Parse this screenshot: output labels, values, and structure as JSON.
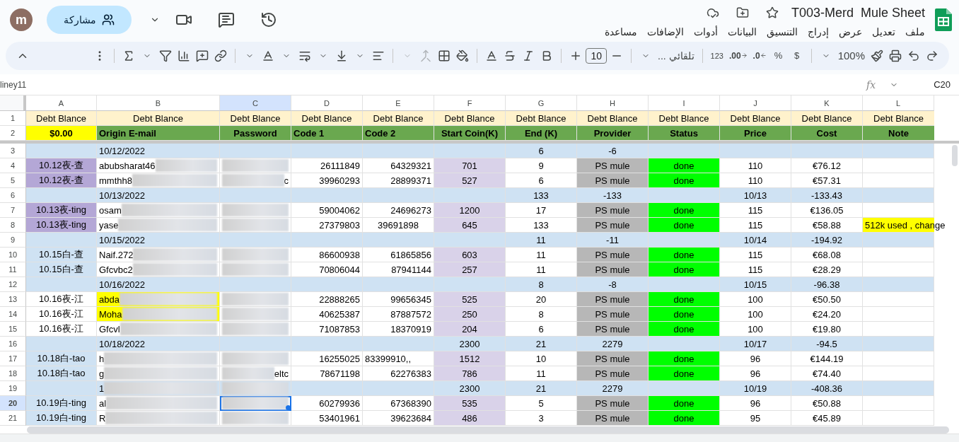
{
  "document": {
    "title": "T003-Merd  Mule Sheet"
  },
  "menu": [
    "ملف",
    "تعديل",
    "عرض",
    "إدراج",
    "التنسيق",
    "البيانات",
    "أدوات",
    "الإضافات",
    "مساعدة"
  ],
  "account": {
    "initial": "m"
  },
  "share_button": {
    "label": "مشاركة"
  },
  "toolbar": {
    "zoom": "100%",
    "currency": "$",
    "percent": "%",
    "decrease_decimal": ".0",
    "increase_decimal": ".00",
    "number_format": "123",
    "font": "تلقائي ...",
    "font_size": "10"
  },
  "formula_bar": {
    "name_box": "C20",
    "content": "liney11",
    "fx_label": "fx"
  },
  "columns": [
    {
      "letter": "A",
      "selected": false
    },
    {
      "letter": "B",
      "selected": false
    },
    {
      "letter": "C",
      "selected": true
    },
    {
      "letter": "D",
      "selected": false
    },
    {
      "letter": "E",
      "selected": false
    },
    {
      "letter": "F",
      "selected": false
    },
    {
      "letter": "G",
      "selected": false
    },
    {
      "letter": "H",
      "selected": false
    },
    {
      "letter": "I",
      "selected": false
    },
    {
      "letter": "J",
      "selected": false
    },
    {
      "letter": "K",
      "selected": false
    },
    {
      "letter": "L",
      "selected": false
    }
  ],
  "rows": [
    {
      "number": "1",
      "kind": "title",
      "selected": false,
      "cells": [
        "Debt Blance",
        "Debt Blance",
        "Debt Blance",
        "Debt Blance",
        "Debt Blance",
        "Debt Blance",
        "Debt Blance",
        "Debt Blance",
        "Debt Blance",
        "Debt Blance",
        "Debt Blance",
        "Debt Blance"
      ]
    },
    {
      "number": "2",
      "kind": "header",
      "selected": false,
      "cells": [
        {
          "text": "$0.00",
          "color": "#ffff00"
        },
        "Origin E-mail",
        "Password",
        "Code 1",
        "Code 2",
        "Start Coin(K)",
        "End (K)",
        "Provider",
        "Status",
        "Price",
        "Cost",
        "Note"
      ]
    },
    {
      "number": "3",
      "kind": "date",
      "selected": false,
      "cells": [
        "",
        "10/12/2022",
        "",
        "",
        "",
        "",
        "6",
        "-6",
        "",
        "",
        "",
        ""
      ]
    },
    {
      "number": "4",
      "kind": "entry",
      "selected": false,
      "cells": [
        {
          "text": "10.12夜-查",
          "color": "#b4a7d6"
        },
        {
          "text": "abubsharat46",
          "redacted": true
        },
        {
          "text": "",
          "redacted": true
        },
        "26111849",
        "64329321",
        "701",
        "9",
        "PS mule",
        "done",
        "110",
        "€76.12",
        ""
      ]
    },
    {
      "number": "5",
      "kind": "entry",
      "selected": false,
      "cells": [
        {
          "text": "10.12夜-查",
          "color": "#b4a7d6"
        },
        {
          "text": "mmthh8",
          "redacted": true
        },
        {
          "text": "c",
          "redacted": true
        },
        "39960293",
        "28899371",
        "527",
        "6",
        "PS mule",
        "done",
        "110",
        "€57.31",
        ""
      ]
    },
    {
      "number": "6",
      "kind": "date",
      "selected": false,
      "cells": [
        "",
        "10/13/2022",
        "",
        "",
        "",
        "",
        "133",
        "-133",
        "",
        "10/13",
        "-133.43",
        ""
      ]
    },
    {
      "number": "7",
      "kind": "entry",
      "selected": false,
      "cells": [
        {
          "text": "10.13夜-ting",
          "color": "#b4a7d6"
        },
        {
          "text": "osam",
          "redacted": true
        },
        {
          "text": "",
          "redacted": true
        },
        "59004062",
        "24696273",
        "1200",
        "17",
        "PS mule",
        "done",
        "115",
        "€136.05",
        ""
      ]
    },
    {
      "number": "8",
      "kind": "entry",
      "selected": false,
      "cells": [
        {
          "text": "10.13夜-ting",
          "color": "#b4a7d6"
        },
        {
          "text": "yase",
          "redacted": true
        },
        {
          "text": "",
          "redacted": true
        },
        "27379803",
        {
          "text": "39691898",
          "centered": true
        },
        "645",
        "133",
        "PS mule",
        "done",
        "115",
        "€58.88",
        {
          "text": "512k used , change",
          "color": "#ffff00"
        }
      ]
    },
    {
      "number": "9",
      "kind": "date",
      "selected": false,
      "cells": [
        "",
        "10/15/2022",
        "",
        "",
        "",
        "",
        "11",
        "-11",
        "",
        "10/14",
        "-194.92",
        ""
      ]
    },
    {
      "number": "10",
      "kind": "entry",
      "selected": false,
      "cells": [
        {
          "text": "10.15白-查",
          "color": "#cfe2f3"
        },
        {
          "text": "Naif.272",
          "redacted": true
        },
        {
          "text": "",
          "redacted": true
        },
        "86600938",
        "61865856",
        "603",
        "11",
        "PS mule",
        "done",
        "115",
        "€68.08",
        ""
      ]
    },
    {
      "number": "11",
      "kind": "entry",
      "selected": false,
      "cells": [
        {
          "text": "10.15白-查",
          "color": "#cfe2f3"
        },
        {
          "text": "Gfcvbc2",
          "redacted": true
        },
        {
          "text": "",
          "redacted": true
        },
        "70806044",
        "87941144",
        "257",
        "11",
        "PS mule",
        "done",
        "115",
        "€28.29",
        ""
      ]
    },
    {
      "number": "12",
      "kind": "date",
      "selected": false,
      "cells": [
        "",
        "10/16/2022",
        "",
        "",
        "",
        "",
        "8",
        "-8",
        "",
        "10/15",
        "-96.38",
        ""
      ]
    },
    {
      "number": "13",
      "kind": "entry",
      "selected": false,
      "cells": [
        "10.16夜-江",
        {
          "text": "abda",
          "redacted": true,
          "color": "#ffff00"
        },
        {
          "text": "",
          "redacted": true
        },
        "22888265",
        "99656345",
        "525",
        "20",
        "PS mule",
        "done",
        "100",
        "€50.50",
        ""
      ]
    },
    {
      "number": "14",
      "kind": "entry",
      "selected": false,
      "cells": [
        "10.16夜-江",
        {
          "text": "Moha",
          "redacted": true,
          "color": "#ffff00"
        },
        {
          "text": "",
          "redacted": true
        },
        "40625387",
        "87887572",
        "250",
        "8",
        "PS mule",
        "done",
        "100",
        "€24.20",
        ""
      ]
    },
    {
      "number": "15",
      "kind": "entry",
      "selected": false,
      "cells": [
        "10.16夜-江",
        {
          "text": "Gfcvl",
          "redacted": true
        },
        {
          "text": "",
          "redacted": true
        },
        "71087853",
        "18370919",
        "204",
        "6",
        "PS mule",
        "done",
        "100",
        "€19.80",
        ""
      ]
    },
    {
      "number": "16",
      "kind": "date",
      "selected": false,
      "cells": [
        "",
        "10/18/2022",
        "",
        "",
        "",
        "2300",
        "21",
        "2279",
        "",
        "10/17",
        "-94.5",
        ""
      ]
    },
    {
      "number": "17",
      "kind": "entry",
      "selected": false,
      "cells": [
        {
          "text": "10.18白-tao",
          "color": "#cfe2f3"
        },
        {
          "text": "h",
          "redacted": true
        },
        {
          "text": "",
          "redacted": true
        },
        "16255025",
        {
          "text": "83399910,,",
          "left_aligned": true
        },
        "1512",
        "10",
        "PS mule",
        "done",
        "96",
        "€144.19",
        ""
      ]
    },
    {
      "number": "18",
      "kind": "entry",
      "selected": false,
      "cells": [
        {
          "text": "10.18白-tao",
          "color": "#cfe2f3"
        },
        {
          "text": "g",
          "redacted": true
        },
        {
          "text": "eltc",
          "redacted": true
        },
        "78671198",
        "62276383",
        "786",
        "11",
        "PS mule",
        "done",
        "96",
        "€74.40",
        ""
      ]
    },
    {
      "number": "19",
      "kind": "date",
      "selected": false,
      "cells": [
        "",
        {
          "text": "1",
          "redacted": true
        },
        {
          "text": "",
          "redacted": true
        },
        "",
        "",
        "2300",
        "21",
        "2279",
        "",
        "10/19",
        "-408.36",
        ""
      ]
    },
    {
      "number": "20",
      "kind": "entry",
      "selected": true,
      "cells": [
        {
          "text": "10.19白-ting",
          "color": "#cfe2f3"
        },
        {
          "text": "al",
          "redacted": true
        },
        {
          "text": "",
          "redacted": true,
          "selected": true
        },
        "60279936",
        "67368390",
        "535",
        "5",
        "PS mule",
        "done",
        "96",
        "€50.88",
        ""
      ]
    },
    {
      "number": "21",
      "kind": "entry",
      "selected": false,
      "cells": [
        {
          "text": "10.19白-ting",
          "color": "#cfe2f3"
        },
        {
          "text": "R",
          "redacted": true
        },
        {
          "text": "",
          "redacted": true
        },
        "53401961",
        "39623684",
        "486",
        "3",
        "PS mule",
        "done",
        "95",
        "€45.89",
        ""
      ]
    }
  ]
}
